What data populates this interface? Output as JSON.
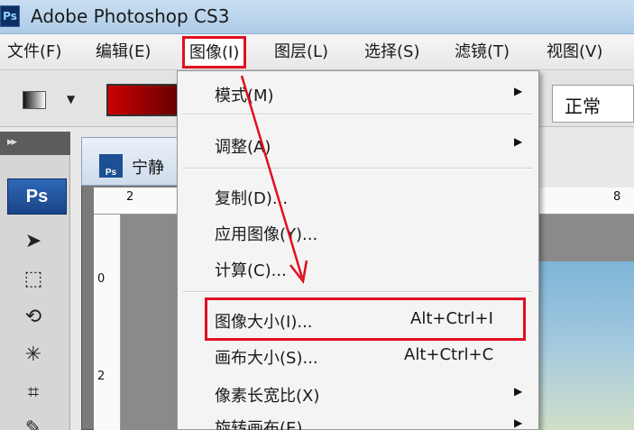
{
  "window": {
    "app_icon": "Ps",
    "title": "Adobe Photoshop CS3"
  },
  "menubar": {
    "items": [
      "文件(F)",
      "编辑(E)",
      "图像(I)",
      "图层(L)",
      "选择(S)",
      "滤镜(T)",
      "视图(V)"
    ],
    "active": "图像(I)"
  },
  "options_bar": {
    "gradient_color": "#cc0000",
    "blend_mode": "正常"
  },
  "toolbox": {
    "badge": "Ps",
    "collapse": "▸▸",
    "tools": [
      "move-tool",
      "marquee-tool",
      "lasso-tool",
      "magic-wand-tool",
      "crop-tool",
      "slice-tool"
    ]
  },
  "document": {
    "tab_icon": "Ps",
    "name": "宁静",
    "ruler_top": [
      "2",
      "8"
    ],
    "ruler_left": [
      "0",
      "2"
    ]
  },
  "image_menu": {
    "items": [
      {
        "label": "模式(M)",
        "submenu": true
      },
      {
        "label": "调整(A)",
        "submenu": true
      },
      {
        "label": "复制(D)..."
      },
      {
        "label": "应用图像(Y)..."
      },
      {
        "label": "计算(C)..."
      },
      {
        "label": "图像大小(I)...",
        "shortcut": "Alt+Ctrl+I",
        "highlighted": true
      },
      {
        "label": "画布大小(S)...",
        "shortcut": "Alt+Ctrl+C"
      },
      {
        "label": "像素长宽比(X)",
        "submenu": true
      },
      {
        "label": "旋转画布(E)",
        "submenu": true
      }
    ]
  },
  "annotation": {
    "color": "#e01020"
  }
}
